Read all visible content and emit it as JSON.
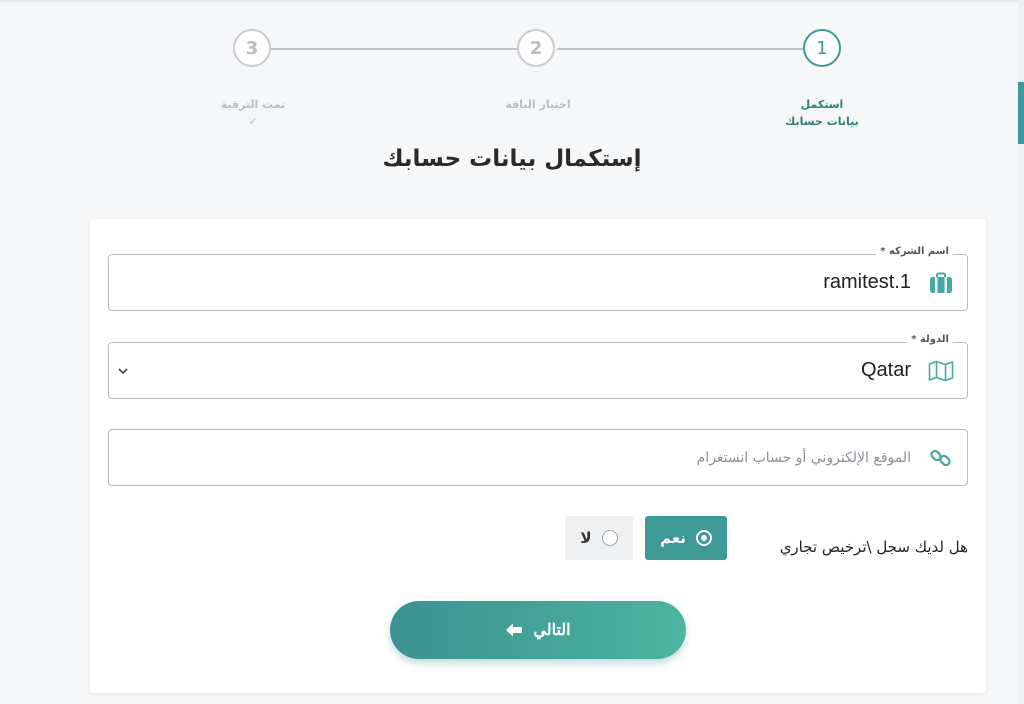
{
  "stepper": {
    "steps": [
      {
        "number": "1",
        "label_line1": "استكمل",
        "label_line2": "بيانات حسابك",
        "state": "active"
      },
      {
        "number": "2",
        "label_line1": "اختيار الباقة",
        "label_line2": "",
        "state": "pending"
      },
      {
        "number": "3",
        "label_line1": "تمت الترقية",
        "label_line2": "✓",
        "state": "pending"
      }
    ]
  },
  "page": {
    "title": "إستكمال بيانات حسابك"
  },
  "form": {
    "company": {
      "label": "اسم الشركه *",
      "value": "ramitest.1",
      "icon": "briefcase-icon"
    },
    "country": {
      "label": "الدولة *",
      "value": "Qatar",
      "icon": "map-icon"
    },
    "website": {
      "placeholder": "الموقع الإلكتروني أو حساب انستغرام",
      "icon": "link-icon"
    },
    "license": {
      "question": "هل لديك سجل \\ترخيص تجاري",
      "yes_label": "نعم",
      "no_label": "لا",
      "selected": "yes"
    },
    "next_label": "التالي"
  },
  "colors": {
    "accent": "#3e9a96",
    "accent_dark": "#2f7f7b"
  }
}
